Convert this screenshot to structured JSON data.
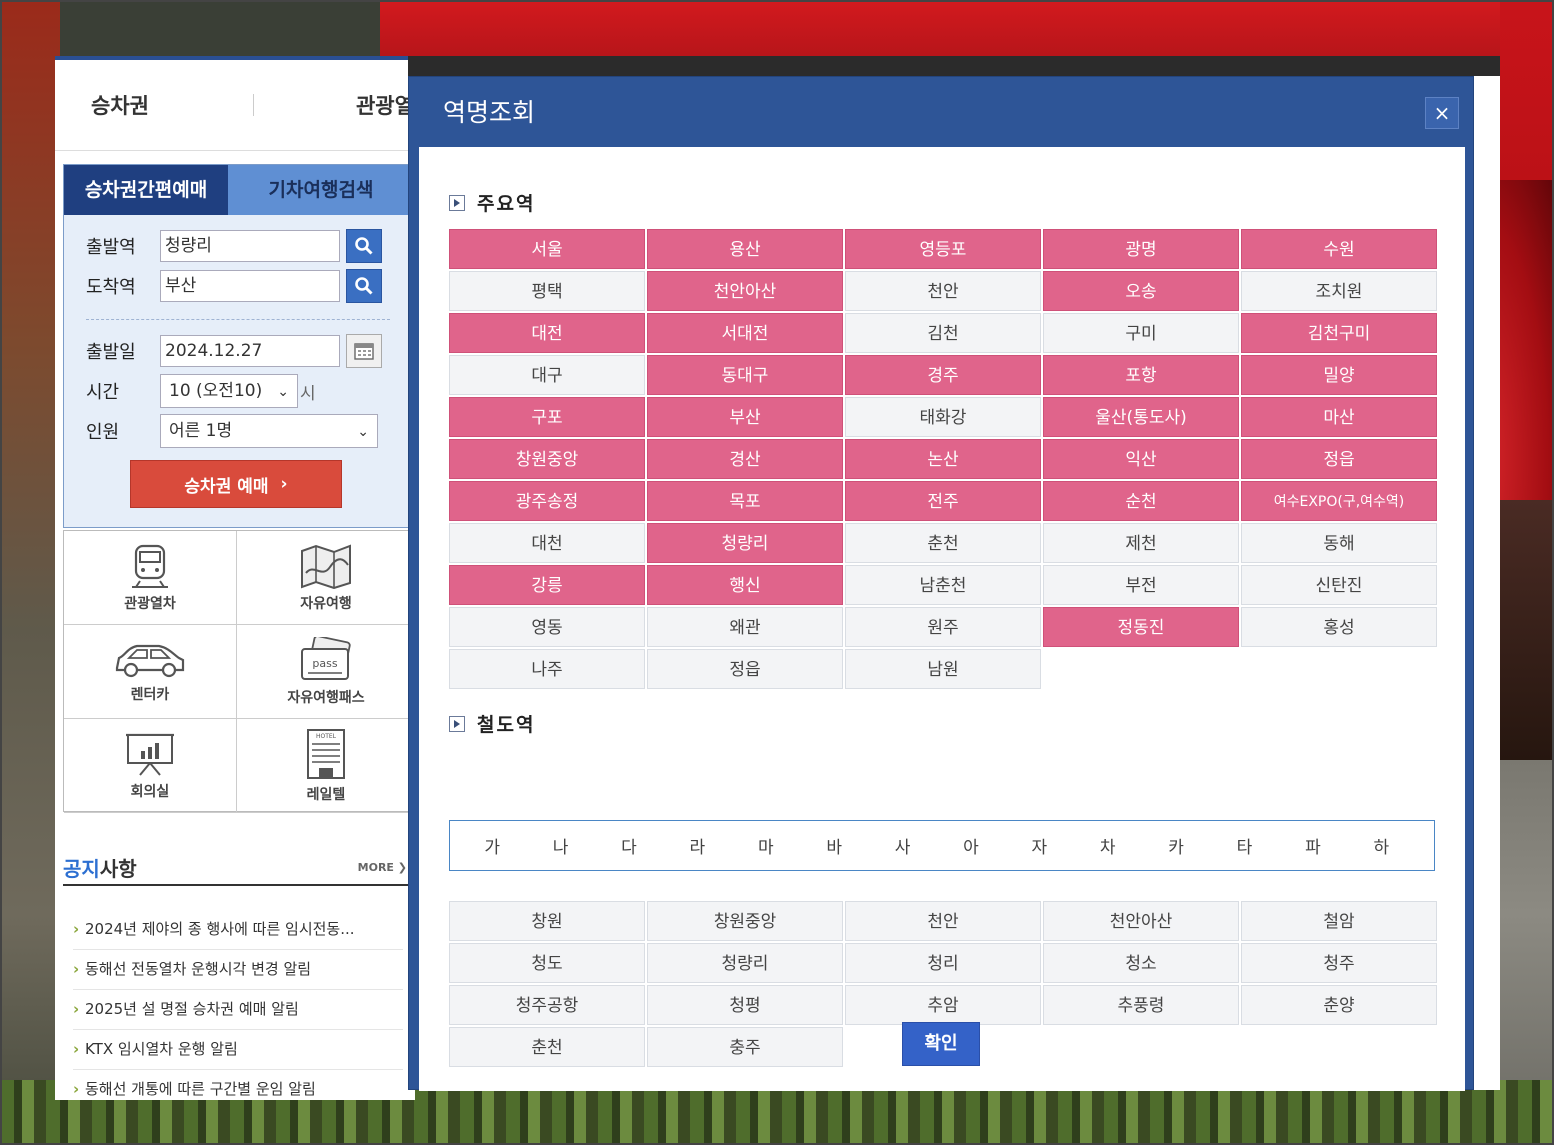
{
  "site": {
    "tabs": [
      "승차권",
      "관광열"
    ],
    "booking": {
      "tab_active": "승차권간편예매",
      "tab_inactive": "기차여행검색",
      "departure_label": "출발역",
      "departure_value": "청량리",
      "arrival_label": "도착역",
      "arrival_value": "부산",
      "date_label": "출발일",
      "date_value": "2024.12.27",
      "time_label": "시간",
      "time_value": "10 (오전10)",
      "time_suffix": "시",
      "passenger_label": "인원",
      "passenger_value": "어른 1명",
      "book_button": "승차권 예매"
    },
    "quick_menu": [
      "관광열차",
      "자유여행",
      "렌터카",
      "자유여행패스",
      "회의실",
      "레일텔"
    ],
    "notice": {
      "title_accent": "공지",
      "title_rest": "사항",
      "more": "MORE",
      "items": [
        "2024년 제야의 종 행사에 따른 임시전동...",
        "동해선 전동열차 운행시각 변경 알림",
        "2025년 설 명절 승차권 예매 알림",
        "KTX 임시열차 운행 알림",
        "동해선 개통에 따른 구간별 운임 알림"
      ]
    }
  },
  "modal": {
    "title": "역명조회",
    "close": "×",
    "major_title": "주요역",
    "major_stations": [
      {
        "name": "서울",
        "h": true
      },
      {
        "name": "용산",
        "h": true
      },
      {
        "name": "영등포",
        "h": true
      },
      {
        "name": "광명",
        "h": true
      },
      {
        "name": "수원",
        "h": true
      },
      {
        "name": "평택",
        "h": false
      },
      {
        "name": "천안아산",
        "h": true
      },
      {
        "name": "천안",
        "h": false
      },
      {
        "name": "오송",
        "h": true
      },
      {
        "name": "조치원",
        "h": false
      },
      {
        "name": "대전",
        "h": true
      },
      {
        "name": "서대전",
        "h": true
      },
      {
        "name": "김천",
        "h": false
      },
      {
        "name": "구미",
        "h": false
      },
      {
        "name": "김천구미",
        "h": true
      },
      {
        "name": "대구",
        "h": false
      },
      {
        "name": "동대구",
        "h": true
      },
      {
        "name": "경주",
        "h": true
      },
      {
        "name": "포항",
        "h": true
      },
      {
        "name": "밀양",
        "h": true
      },
      {
        "name": "구포",
        "h": true
      },
      {
        "name": "부산",
        "h": true
      },
      {
        "name": "태화강",
        "h": false
      },
      {
        "name": "울산(통도사)",
        "h": true
      },
      {
        "name": "마산",
        "h": true
      },
      {
        "name": "창원중앙",
        "h": true
      },
      {
        "name": "경산",
        "h": true
      },
      {
        "name": "논산",
        "h": true
      },
      {
        "name": "익산",
        "h": true
      },
      {
        "name": "정읍",
        "h": true
      },
      {
        "name": "광주송정",
        "h": true
      },
      {
        "name": "목포",
        "h": true
      },
      {
        "name": "전주",
        "h": true
      },
      {
        "name": "순천",
        "h": true
      },
      {
        "name": "여수EXPO(구,여수역)",
        "h": true
      },
      {
        "name": "대천",
        "h": false
      },
      {
        "name": "청량리",
        "h": true
      },
      {
        "name": "춘천",
        "h": false
      },
      {
        "name": "제천",
        "h": false
      },
      {
        "name": "동해",
        "h": false
      },
      {
        "name": "강릉",
        "h": true
      },
      {
        "name": "행신",
        "h": true
      },
      {
        "name": "남춘천",
        "h": false
      },
      {
        "name": "부전",
        "h": false
      },
      {
        "name": "신탄진",
        "h": false
      },
      {
        "name": "영동",
        "h": false
      },
      {
        "name": "왜관",
        "h": false
      },
      {
        "name": "원주",
        "h": false
      },
      {
        "name": "정동진",
        "h": true
      },
      {
        "name": "홍성",
        "h": false
      },
      {
        "name": "나주",
        "h": false
      },
      {
        "name": "정읍",
        "h": false
      },
      {
        "name": "남원",
        "h": false
      }
    ],
    "rail_title": "철도역",
    "consonants": [
      "가",
      "나",
      "다",
      "라",
      "마",
      "바",
      "사",
      "아",
      "자",
      "차",
      "카",
      "타",
      "파",
      "하"
    ],
    "rail_stations": [
      "창원",
      "창원중앙",
      "천안",
      "천안아산",
      "철암",
      "청도",
      "청량리",
      "청리",
      "청소",
      "청주",
      "청주공항",
      "청평",
      "추암",
      "추풍령",
      "춘양",
      "춘천",
      "충주"
    ],
    "confirm": "확인",
    "colors": {
      "highlight": "#e0648b",
      "header": "#2e5597",
      "button": "#3462c8"
    }
  }
}
